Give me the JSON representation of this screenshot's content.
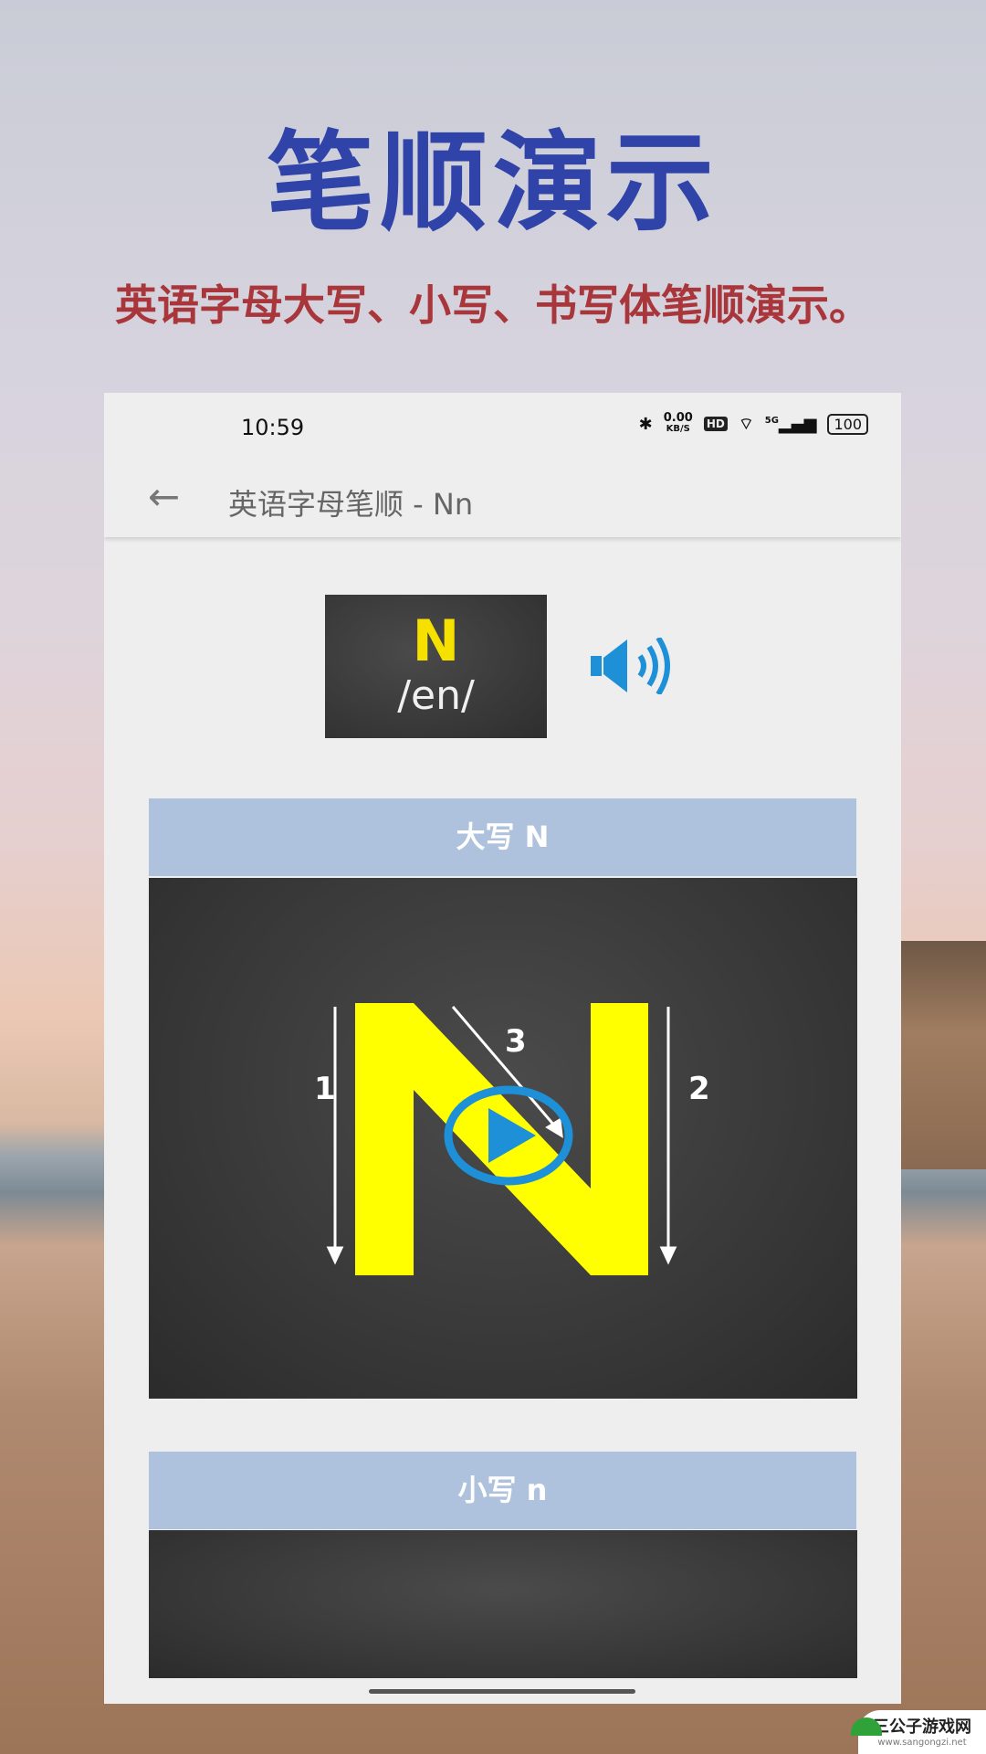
{
  "promo": {
    "title": "笔顺演示",
    "subtitle": "英语字母大写、小写、书写体笔顺演示。"
  },
  "status_bar": {
    "time": "10:59",
    "net_speed": "0.00",
    "net_unit": "KB/S",
    "hd": "HD",
    "network": "5G",
    "battery": "100"
  },
  "app_bar": {
    "title": "英语字母笔顺 - Nn"
  },
  "letter_card": {
    "letter": "N",
    "phonetic": "/en/"
  },
  "sections": [
    {
      "label": "大写 N",
      "stroke_labels": [
        "1",
        "2",
        "3"
      ]
    },
    {
      "label": "小写 n"
    }
  ],
  "colors": {
    "title": "#2f43a8",
    "subtitle": "#a8363a",
    "banner": "#aec2dd",
    "letter": "#ffff00",
    "accent": "#1e90d8"
  },
  "watermark": {
    "name": "三公子游戏网",
    "url": "www.sangongzi.net"
  }
}
